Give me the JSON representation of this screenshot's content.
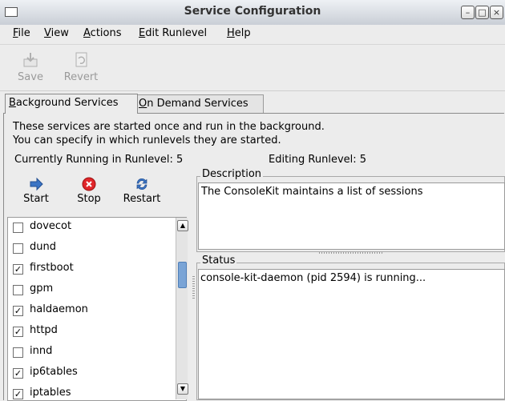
{
  "window": {
    "title": "Service Configuration"
  },
  "menu": [
    {
      "key": "F",
      "rest": "ile"
    },
    {
      "key": "V",
      "rest": "iew"
    },
    {
      "key": "A",
      "rest": "ctions"
    },
    {
      "key": "E",
      "rest": "dit Runlevel"
    },
    {
      "key": "H",
      "rest": "elp"
    }
  ],
  "toolbar": {
    "save_label": "Save",
    "revert_label": "Revert"
  },
  "tabs": [
    {
      "key": "B",
      "rest": "ackground Services"
    },
    {
      "key": "O",
      "rest": "n Demand Services"
    }
  ],
  "panel": {
    "description_line1": "These services are started once and run in the background.",
    "description_line2": "You can specify in which runlevels they are started.",
    "running_runlevel": "Currently Running in Runlevel: 5",
    "editing_runlevel": "Editing Runlevel: 5"
  },
  "controls": {
    "start_label": "Start",
    "stop_label": "Stop",
    "restart_label": "Restart"
  },
  "services": [
    {
      "name": "dovecot",
      "checked": false
    },
    {
      "name": "dund",
      "checked": false
    },
    {
      "name": "firstboot",
      "checked": true
    },
    {
      "name": "gpm",
      "checked": false
    },
    {
      "name": "haldaemon",
      "checked": true
    },
    {
      "name": "httpd",
      "checked": true
    },
    {
      "name": "innd",
      "checked": false
    },
    {
      "name": "ip6tables",
      "checked": true
    },
    {
      "name": "iptables",
      "checked": true
    }
  ],
  "description": {
    "label": "Description",
    "text": "The ConsoleKit maintains a list of sessions"
  },
  "status": {
    "label": "Status",
    "text": "console-kit-daemon (pid 2594) is running..."
  },
  "colors": {
    "accent": "#3b74c4",
    "stop_red": "#e0262a",
    "scroll_thumb": "#7aa4d6"
  }
}
